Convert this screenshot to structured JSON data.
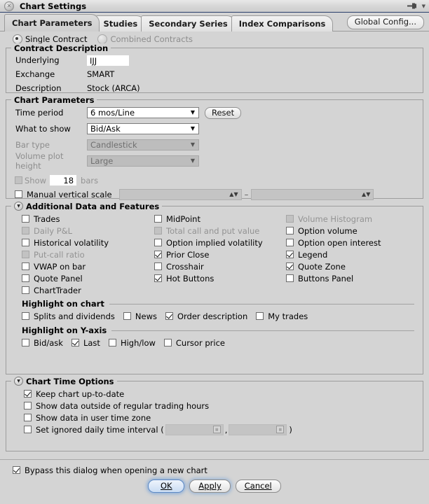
{
  "window": {
    "title": "Chart Settings",
    "close_icon": "close-circle-icon",
    "pin_icon": "pin-icon",
    "menu_icon": "chevron-down-icon"
  },
  "tabs": [
    {
      "label": "Chart Parameters",
      "active": true
    },
    {
      "label": "Studies",
      "active": false
    },
    {
      "label": "Secondary Series",
      "active": false
    },
    {
      "label": "Index Comparisons",
      "active": false
    }
  ],
  "global_config_button": "Global Config...",
  "contract_mode": {
    "single": {
      "label": "Single Contract",
      "selected": true,
      "enabled": true
    },
    "combined": {
      "label": "Combined Contracts",
      "selected": false,
      "enabled": false
    }
  },
  "contract_description": {
    "title": "Contract Description",
    "underlying_label": "Underlying",
    "underlying_value": "IJJ",
    "exchange_label": "Exchange",
    "exchange_value": "SMART",
    "description_label": "Description",
    "description_value": "Stock (ARCA)"
  },
  "chart_parameters": {
    "title": "Chart Parameters",
    "time_period_label": "Time period",
    "time_period_value": "6 mos/Line",
    "reset_button": "Reset",
    "what_to_show_label": "What to show",
    "what_to_show_value": "Bid/Ask",
    "bar_type_label": "Bar type",
    "bar_type_value": "Candlestick",
    "volume_plot_height_label": "Volume plot height",
    "volume_plot_height_value": "Large",
    "show_bars_label": "Show",
    "show_bars_value": "18",
    "show_bars_suffix": "bars",
    "show_bars_checked": false,
    "manual_vertical_scale_label": "Manual vertical scale",
    "manual_vertical_scale_checked": false,
    "manual_scale_separator": "–"
  },
  "additional_data": {
    "title": "Additional Data and Features",
    "columns": [
      [
        {
          "label": "Trades",
          "checked": false,
          "enabled": true
        },
        {
          "label": "Daily P&L",
          "checked": false,
          "enabled": false
        },
        {
          "label": "Historical volatility",
          "checked": false,
          "enabled": true
        },
        {
          "label": "Put-call ratio",
          "checked": false,
          "enabled": false
        },
        {
          "label": "VWAP on bar",
          "checked": false,
          "enabled": true
        },
        {
          "label": "Quote Panel",
          "checked": false,
          "enabled": true
        },
        {
          "label": "ChartTrader",
          "checked": false,
          "enabled": true
        }
      ],
      [
        {
          "label": "MidPoint",
          "checked": false,
          "enabled": true
        },
        {
          "label": "Total call and put value",
          "checked": false,
          "enabled": false
        },
        {
          "label": "Option implied volatility",
          "checked": false,
          "enabled": true
        },
        {
          "label": "Prior Close",
          "checked": true,
          "enabled": true
        },
        {
          "label": "Crosshair",
          "checked": false,
          "enabled": true
        },
        {
          "label": "Hot Buttons",
          "checked": true,
          "enabled": true
        }
      ],
      [
        {
          "label": "Volume Histogram",
          "checked": false,
          "enabled": false
        },
        {
          "label": "Option volume",
          "checked": false,
          "enabled": true
        },
        {
          "label": "Option open interest",
          "checked": false,
          "enabled": true
        },
        {
          "label": "Legend",
          "checked": true,
          "enabled": true
        },
        {
          "label": "Quote Zone",
          "checked": true,
          "enabled": true
        },
        {
          "label": "Buttons Panel",
          "checked": false,
          "enabled": true
        }
      ]
    ],
    "highlight_on_chart": {
      "title": "Highlight on chart",
      "items": [
        {
          "label": "Splits and dividends",
          "checked": false
        },
        {
          "label": "News",
          "checked": false
        },
        {
          "label": "Order description",
          "checked": true
        },
        {
          "label": "My trades",
          "checked": false
        }
      ]
    },
    "highlight_on_yaxis": {
      "title": "Highlight on Y-axis",
      "items": [
        {
          "label": "Bid/ask",
          "checked": false
        },
        {
          "label": "Last",
          "checked": true
        },
        {
          "label": "High/low",
          "checked": false
        },
        {
          "label": "Cursor price",
          "checked": false
        }
      ]
    }
  },
  "chart_time_options": {
    "title": "Chart Time Options",
    "items": [
      {
        "label": "Keep chart up-to-date",
        "checked": true
      },
      {
        "label": "Show data outside of regular trading hours",
        "checked": false
      },
      {
        "label": "Show data in user time zone",
        "checked": false
      }
    ],
    "ignored_interval": {
      "label": "Set ignored daily time interval (",
      "checked": false,
      "separator": ",",
      "close": ")",
      "from_value": "",
      "to_value": ""
    }
  },
  "bypass": {
    "label": "Bypass this dialog when opening a new chart",
    "checked": true
  },
  "buttons": {
    "ok": "OK",
    "apply": "Apply",
    "cancel": "Cancel"
  }
}
